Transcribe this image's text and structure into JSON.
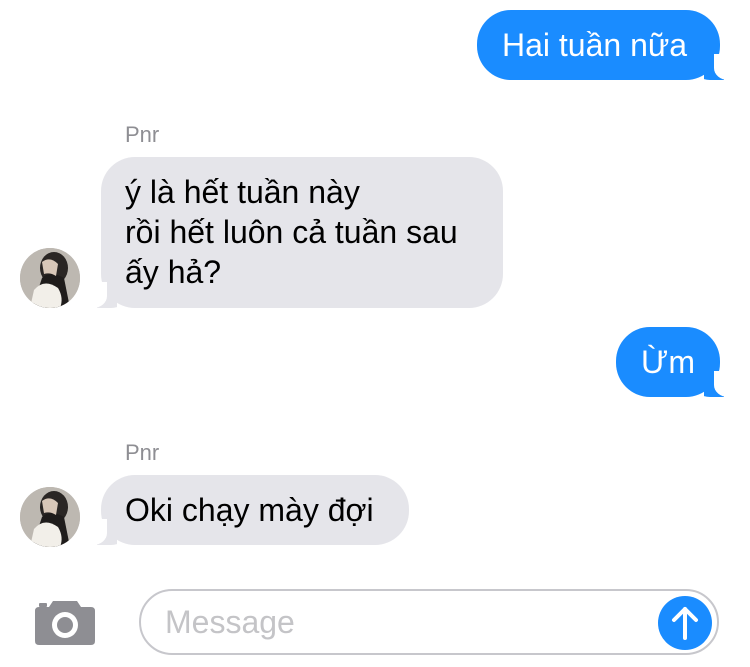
{
  "colors": {
    "outgoing_bubble": "#1a8cff",
    "incoming_bubble": "#e5e5ea",
    "sender_name": "#8e8e93",
    "placeholder": "#c4c4c7"
  },
  "messages": [
    {
      "direction": "outgoing",
      "lines": [
        "Hai tuần nữa"
      ]
    },
    {
      "direction": "incoming",
      "sender": "Pnr",
      "lines": [
        "ý là hết tuần này",
        "rồi hết luôn cả tuần sau",
        "ấy hả?"
      ],
      "avatar": "contact-avatar"
    },
    {
      "direction": "outgoing",
      "lines": [
        "Ừm"
      ]
    },
    {
      "direction": "incoming",
      "sender": "Pnr",
      "lines": [
        "Oki chạy mày đợi"
      ],
      "avatar": "contact-avatar"
    }
  ],
  "composer": {
    "placeholder": "Message",
    "value": "",
    "camera_icon": "camera-icon",
    "send_icon": "arrow-up-icon"
  }
}
